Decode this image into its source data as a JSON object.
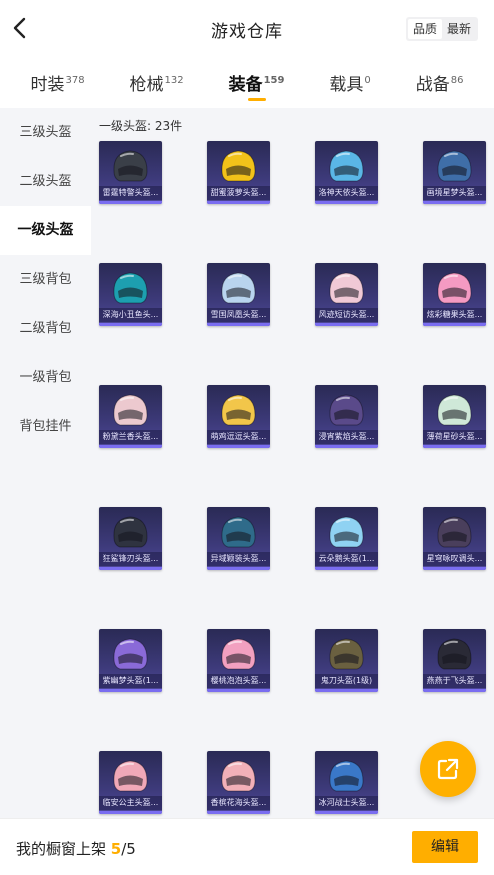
{
  "header": {
    "title": "游戏仓库",
    "sort_options": [
      "品质",
      "最新"
    ]
  },
  "tabs": [
    {
      "label": "时装",
      "count": "378"
    },
    {
      "label": "枪械",
      "count": "132"
    },
    {
      "label": "装备",
      "count": "159"
    },
    {
      "label": "载具",
      "count": "0"
    },
    {
      "label": "战备",
      "count": "86"
    }
  ],
  "sidebar": {
    "items": [
      "三级头盔",
      "二级头盔",
      "一级头盔",
      "三级背包",
      "二级背包",
      "一级背包",
      "背包挂件"
    ]
  },
  "content": {
    "heading": "一级头盔: 23件",
    "items": [
      {
        "name": "雷霆特警头盔...",
        "color": "#3a3f48"
      },
      {
        "name": "甜蜜菠萝头盔...",
        "color": "#f2c21a"
      },
      {
        "name": "洛神天依头盔...",
        "color": "#5ab6e6"
      },
      {
        "name": "画境星梦头盔...",
        "color": "#3f6ea8"
      },
      {
        "name": "深海小丑鱼头...",
        "color": "#1d9fb0"
      },
      {
        "name": "雪国凤凰头盔...",
        "color": "#b9d4ee"
      },
      {
        "name": "风迹短访头盔...",
        "color": "#f0c9d6"
      },
      {
        "name": "炫彩糖果头盔...",
        "color": "#f49ac2"
      },
      {
        "name": "粉黛兰香头盔...",
        "color": "#ecc9cf"
      },
      {
        "name": "萌鸡逗逗头盔...",
        "color": "#f2c64a"
      },
      {
        "name": "浸宵紫焰头盔...",
        "color": "#5a4a8a"
      },
      {
        "name": "薄荷星砂头盔...",
        "color": "#cfe8d8"
      },
      {
        "name": "狂鲨锋刃头盔...",
        "color": "#2f3340"
      },
      {
        "name": "异域颖装头盔...",
        "color": "#2f6b8a"
      },
      {
        "name": "云朵鹅头盔(1...",
        "color": "#8fd2f2"
      },
      {
        "name": "星穹咏叹调头...",
        "color": "#4a3f5c"
      },
      {
        "name": "紫幽梦头盔(1...",
        "color": "#8a6ad8"
      },
      {
        "name": "樱桃泡泡头盔...",
        "color": "#f2a0c0"
      },
      {
        "name": "鬼刀头盔(1级)",
        "color": "#6a6040"
      },
      {
        "name": "燕燕于飞头盔...",
        "color": "#2a2a36"
      },
      {
        "name": "临安公主头盔...",
        "color": "#f0a8b8"
      },
      {
        "name": "香槟花海头盔...",
        "color": "#f2b0b8"
      },
      {
        "name": "冰河战士头盔...",
        "color": "#3a78c8"
      }
    ]
  },
  "footer": {
    "label": "我的橱窗上架",
    "current": "5",
    "total": "/5",
    "edit_label": "编辑"
  },
  "accent": "#ffae00"
}
